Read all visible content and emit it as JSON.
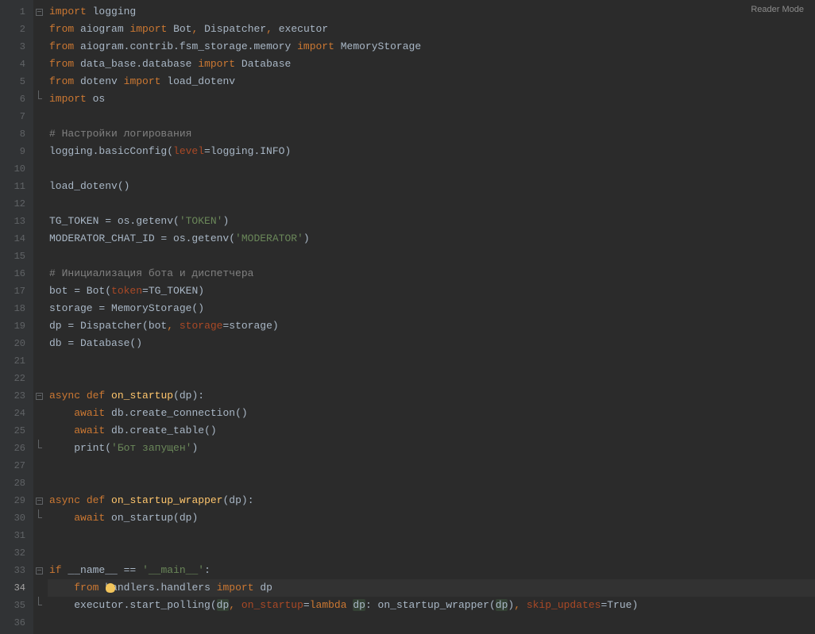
{
  "reader_mode_label": "Reader Mode",
  "lines": [
    {
      "n": 1,
      "fold": "minus"
    },
    {
      "n": 2
    },
    {
      "n": 3
    },
    {
      "n": 4
    },
    {
      "n": 5
    },
    {
      "n": 6,
      "fold": "end"
    },
    {
      "n": 7
    },
    {
      "n": 8
    },
    {
      "n": 9
    },
    {
      "n": 10
    },
    {
      "n": 11
    },
    {
      "n": 12
    },
    {
      "n": 13
    },
    {
      "n": 14
    },
    {
      "n": 15
    },
    {
      "n": 16
    },
    {
      "n": 17
    },
    {
      "n": 18
    },
    {
      "n": 19
    },
    {
      "n": 20
    },
    {
      "n": 21
    },
    {
      "n": 22
    },
    {
      "n": 23,
      "fold": "minus"
    },
    {
      "n": 24
    },
    {
      "n": 25
    },
    {
      "n": 26,
      "fold": "end"
    },
    {
      "n": 27
    },
    {
      "n": 28
    },
    {
      "n": 29,
      "fold": "minus"
    },
    {
      "n": 30,
      "fold": "end"
    },
    {
      "n": 31
    },
    {
      "n": 32
    },
    {
      "n": 33,
      "fold": "minus",
      "run": true
    },
    {
      "n": 34,
      "current": true,
      "bulb": true
    },
    {
      "n": 35,
      "fold": "end"
    },
    {
      "n": 36
    }
  ],
  "code": {
    "l1": {
      "import": "import",
      "logging": "logging"
    },
    "l2": {
      "from": "from",
      "aiogram": "aiogram",
      "import": "import",
      "bot": "Bot",
      "comma1": ",",
      "dispatcher": "Dispatcher",
      "comma2": ",",
      "executor": "executor"
    },
    "l3": {
      "from": "from",
      "path": "aiogram.contrib.fsm_storage.memory",
      "import": "import",
      "memorystorage": "MemoryStorage"
    },
    "l4": {
      "from": "from",
      "path": "data_base.database",
      "import": "import",
      "database": "Database"
    },
    "l5": {
      "from": "from",
      "dotenv": "dotenv",
      "import": "import",
      "load_dotenv": "load_dotenv"
    },
    "l6": {
      "import": "import",
      "os": "os"
    },
    "l8": {
      "comment": "# Настройки логирования"
    },
    "l9": {
      "logging": "logging.basicConfig(",
      "level": "level",
      "eq": "=logging.INFO)"
    },
    "l11": {
      "text": "load_dotenv()"
    },
    "l13": {
      "pre": "TG_TOKEN = os.getenv(",
      "str": "'TOKEN'",
      "post": ")"
    },
    "l14": {
      "pre": "MODERATOR_CHAT_ID = os.getenv(",
      "str": "'MODERATOR'",
      "post": ")"
    },
    "l16": {
      "comment": "# Инициализация бота и диспетчера"
    },
    "l17": {
      "pre": "bot = Bot(",
      "token": "token",
      "post": "=TG_TOKEN)"
    },
    "l18": {
      "text": "storage = MemoryStorage()"
    },
    "l19": {
      "pre": "dp = Dispatcher(bot",
      "comma": ",",
      "storage": "storage",
      "post": "=storage)"
    },
    "l20": {
      "text": "db = Database()"
    },
    "l23": {
      "async": "async",
      "def": "def",
      "name": "on_startup",
      "params": "(dp):"
    },
    "l24": {
      "await": "await",
      "rest": "db.create_connection()"
    },
    "l25": {
      "await": "await",
      "rest": "db.create_table()"
    },
    "l26": {
      "print": "print(",
      "str": "'Бот запущен'",
      "post": ")"
    },
    "l29": {
      "async": "async",
      "def": "def",
      "name": "on_startup_wrapper",
      "params": "(dp):"
    },
    "l30": {
      "await": "await",
      "rest": "on_startup(dp)"
    },
    "l33": {
      "if": "if",
      "name": "__name__ ==",
      "str": "'__main__'",
      "colon": ":"
    },
    "l34": {
      "from": "from",
      "path": "handlers.handlers",
      "import": "import",
      "dp": "dp"
    },
    "l35": {
      "pre": "executor.start_polling(",
      "dp1": "dp",
      "c1": ",",
      "on_startup": "on_startup",
      "eq1": "=",
      "lambda": "lambda",
      "dp2": "dp",
      "colon": ": on_startup_wrapper(",
      "dp3": "dp",
      "paren": ")",
      "c2": ",",
      "skip": "skip_updates",
      "eq2": "=True)"
    }
  }
}
